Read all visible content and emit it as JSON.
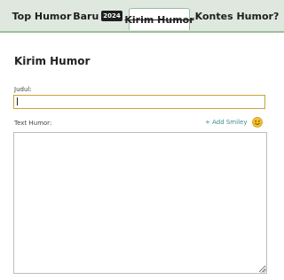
{
  "nav": {
    "tabs": [
      {
        "label": "Top Humor"
      },
      {
        "label": "Baru",
        "badge": "2024"
      },
      {
        "label": "Kirim Humor",
        "active": true
      },
      {
        "label": "Kontes Humor?"
      }
    ]
  },
  "form": {
    "title": "Kirim Humor",
    "judul_label": "Judul:",
    "judul_value": "",
    "text_label": "Text Humor:",
    "text_value": "",
    "add_smiley_label": "+ Add Smiley",
    "smiley_icon": "smiley-face-icon"
  },
  "colors": {
    "nav_bg": "#dfe8df",
    "accent_link": "#3f8a8f",
    "input_focus_border": "#c9a43a",
    "smiley_fill": "#f2c12e"
  }
}
